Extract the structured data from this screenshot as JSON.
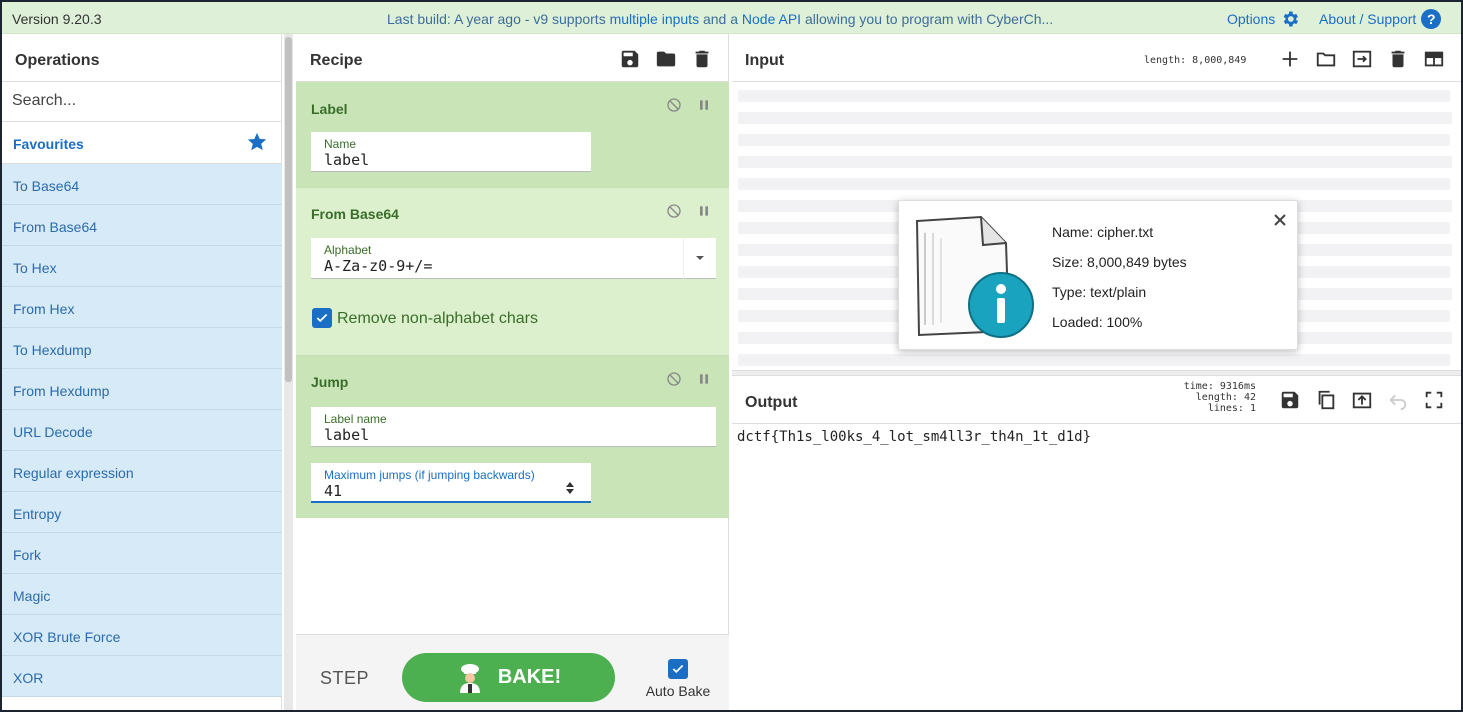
{
  "banner": {
    "version": "Version 9.20.3",
    "build_prefix": "Last build: A year ago - v9 supports ",
    "build_link1": "multiple inputs",
    "build_mid": " and a ",
    "build_link2": "Node API",
    "build_suffix": " allowing you to program with CyberCh...",
    "options": "Options",
    "about": "About / Support"
  },
  "operations": {
    "title": "Operations",
    "search_placeholder": "Search...",
    "favourites_label": "Favourites",
    "items": [
      "To Base64",
      "From Base64",
      "To Hex",
      "From Hex",
      "To Hexdump",
      "From Hexdump",
      "URL Decode",
      "Regular expression",
      "Entropy",
      "Fork",
      "Magic",
      "XOR Brute Force",
      "XOR"
    ]
  },
  "recipe": {
    "title": "Recipe",
    "ops": [
      {
        "name": "Label",
        "fields": [
          {
            "label": "Name",
            "value": "label"
          }
        ]
      },
      {
        "name": "From Base64",
        "fields": [
          {
            "label": "Alphabet",
            "value": "A-Za-z0-9+/="
          }
        ],
        "checkbox": {
          "label": "Remove non-alphabet chars",
          "checked": true
        }
      },
      {
        "name": "Jump",
        "fields": [
          {
            "label": "Label name",
            "value": "label"
          },
          {
            "label": "Maximum jumps (if jumping backwards)",
            "value": "41"
          }
        ]
      }
    ],
    "step_label": "STEP",
    "bake_label": "BAKE!",
    "autobake_label": "Auto Bake",
    "autobake_checked": true
  },
  "input": {
    "title": "Input",
    "length_text": "length: 8,000,849",
    "file": {
      "name": "Name: cipher.txt",
      "size": "Size: 8,000,849 bytes",
      "type": "Type: text/plain",
      "loaded": "Loaded: 100%"
    }
  },
  "output": {
    "title": "Output",
    "time": "time: 9316ms",
    "length": "length:   42",
    "lines": "lines:    1",
    "text": "dctf{Th1s_l00ks_4_lot_sm4ll3r_th4n_1t_d1d}"
  },
  "colors": {
    "banner_bg": "#dff0d8",
    "accent": "#1a6fc4",
    "favourite_bg": "#d7eaf8",
    "recipe_green": "#c9e5b7",
    "bake_green": "#4caf50"
  }
}
